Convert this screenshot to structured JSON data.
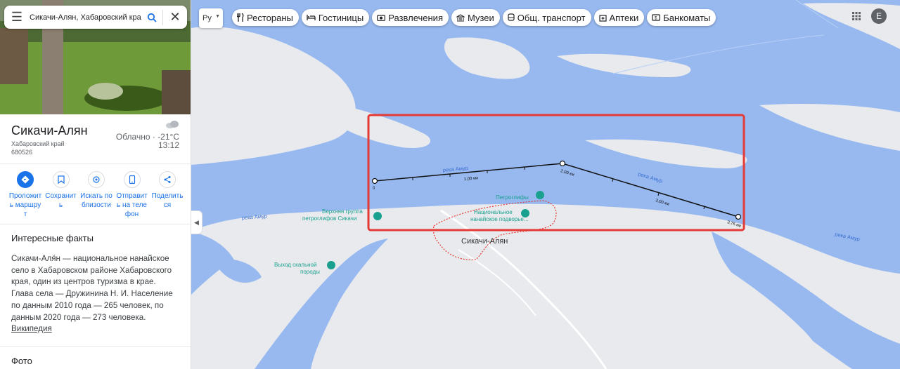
{
  "search": {
    "query": "Сикачи-Алян, Хабаровский край"
  },
  "place": {
    "title": "Сикачи-Алян",
    "region": "Хабаровский край",
    "postcode": "680526",
    "weather_condition": "Облачно · -21°C",
    "weather_time": "13:12"
  },
  "actions": [
    {
      "label": "Проложить маршрут",
      "icon": "directions-icon"
    },
    {
      "label": "Сохранить",
      "icon": "bookmark-icon"
    },
    {
      "label": "Искать поблизости",
      "icon": "nearby-icon"
    },
    {
      "label": "Отправить на телефон",
      "icon": "phone-icon"
    },
    {
      "label": "Поделиться",
      "icon": "share-icon"
    }
  ],
  "facts": {
    "heading": "Интересные факты",
    "text": "Сикачи-Аля́н — национальное нанайское село в Хабаровском районе Хабаровского края, один из центров туризма в крае. Глава села — Дружинина Н. И. Население по данным 2010 года — 265 человек, по данным 2020 года — 273 человека.",
    "source": "Википедия"
  },
  "photos": {
    "heading": "Фото"
  },
  "toolbar": {
    "language": "Ру",
    "chips": [
      {
        "label": "Рестораны",
        "icon": "restaurant-icon"
      },
      {
        "label": "Гостиницы",
        "icon": "hotel-icon"
      },
      {
        "label": "Развлечения",
        "icon": "camera-icon"
      },
      {
        "label": "Музеи",
        "icon": "museum-icon"
      },
      {
        "label": "Общ. транспорт",
        "icon": "transit-icon"
      },
      {
        "label": "Аптеки",
        "icon": "pharmacy-icon"
      },
      {
        "label": "Банкоматы",
        "icon": "atm-icon"
      }
    ],
    "account_initial": "E"
  },
  "map": {
    "colors": {
      "water": "#97b9f0",
      "land": "#e8eaed",
      "measure_box": "#e53935",
      "poi": "#1aa08e",
      "boundary": "#e53935"
    },
    "labels": {
      "river_1": "река Амур",
      "river_2": "река Амур",
      "river_3": "река Амур",
      "river_4": "река Амур",
      "poi_petroglyphs": "Петроглифы",
      "poi_upper_group": "Верхняя группа петроглифов Сикачи",
      "poi_courtyard": "Национальное нанайское подворье...",
      "poi_rock": "Выход скальной породы",
      "village": "Сикачи-Алян"
    },
    "measure": {
      "start": "0",
      "tick_1": "1,00 км",
      "tick_2": "2,00 км",
      "tick_3": "3,00 км",
      "total": "3,75 км"
    }
  }
}
